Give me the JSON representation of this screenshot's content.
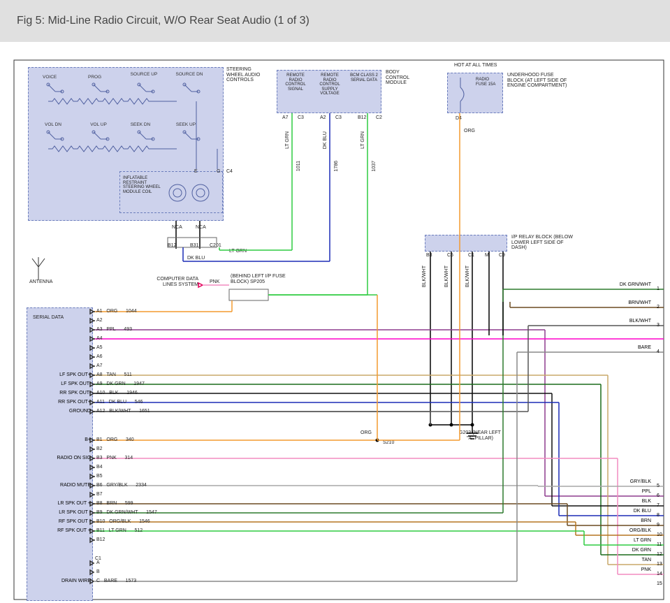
{
  "header": {
    "title": "Fig 5: Mid-Line Radio Circuit, W/O Rear Seat Audio (1 of 3)"
  },
  "modules": {
    "steering": {
      "title": "STEERING WHEEL AUDIO CONTROLS",
      "buttons": [
        "VOICE",
        "PROG",
        "SOURCE UP",
        "SOURCE DN",
        "VOL DN",
        "VOL UP",
        "SEEK DN",
        "SEEK UP"
      ],
      "coil": "INFLATABLE RESTRAINT STEERING WHEEL MODULE COIL"
    },
    "bcm": {
      "title": "BODY CONTROL MODULE",
      "col1": "REMOTE RADIO CONTROL SIGNAL",
      "col2": "REMOTE RADIO CONTROL SUPPLY VOLTAGE",
      "col3": "BCM CLASS 2 SERIAL DATA"
    },
    "bcm_pins": {
      "p1": "A7",
      "c1": "C3",
      "p2": "A2",
      "c2": "C3",
      "p3": "B12",
      "c3": "C2"
    },
    "bcm_wires": {
      "w1": "LT GRN",
      "n1": "1011",
      "w2": "DK BLU",
      "n2": "1786",
      "w3": "LT GRN",
      "n3": "1037"
    },
    "fuseblock": {
      "title": "UNDERHOOD FUSE BLOCK (AT LEFT SIDE OF ENGINE COMPARTMENT)",
      "hot": "HOT AT ALL TIMES",
      "fuse": "RADIO FUSE 15A",
      "pin": "D4",
      "wire": "ORG"
    },
    "iprelay": {
      "title": "I/P RELAY BLOCK (BELOW LOWER LEFT SIDE OF DASH)",
      "pins": [
        "B3",
        "C5",
        "C1",
        "M",
        "C9"
      ]
    },
    "sp205": {
      "text": "(BEHIND LEFT I/P FUSE BLOCK) SP205"
    },
    "datasys": {
      "text": "COMPUTER DATA LINES SYSTEM",
      "wire": "PNK"
    },
    "g203": {
      "text": "G203 (NEAR LEFT \"A\" PILLAR)"
    },
    "s210": "S210",
    "antenna": "ANTENNA",
    "blkwht": "BLK/WHT"
  },
  "coil_pins": {
    "e": "E",
    "g": "G",
    "c4": "C4",
    "nca": "NCA",
    "b12": "B12",
    "b31": "B31",
    "c201": "C201",
    "dkblu": "DK BLU",
    "ltgrn": "LT GRN"
  },
  "radio": {
    "serial": "SERIAL DATA",
    "rows_a": [
      {
        "pin": "A1",
        "c": "ORG",
        "n": "1044",
        "left": ""
      },
      {
        "pin": "A2",
        "c": "",
        "n": "",
        "left": ""
      },
      {
        "pin": "A3",
        "c": "PPL",
        "n": "493",
        "left": ""
      },
      {
        "pin": "A4",
        "c": "",
        "n": "",
        "left": ""
      },
      {
        "pin": "A5",
        "c": "",
        "n": "",
        "left": ""
      },
      {
        "pin": "A6",
        "c": "",
        "n": "",
        "left": ""
      },
      {
        "pin": "A7",
        "c": "",
        "n": "",
        "left": ""
      },
      {
        "pin": "A8",
        "c": "TAN",
        "n": "511",
        "left": "LF SPK OUT+"
      },
      {
        "pin": "A9",
        "c": "DK GRN",
        "n": "1947",
        "left": "LF SPK OUT-"
      },
      {
        "pin": "A10",
        "c": "BLK",
        "n": "1946",
        "left": "RR SPK OUT-"
      },
      {
        "pin": "A11",
        "c": "DK BLU",
        "n": "546",
        "left": "RR SPK OUT+"
      },
      {
        "pin": "A12",
        "c": "BLK/WHT",
        "n": "1651",
        "left": "GROUND"
      }
    ],
    "rows_b": [
      {
        "pin": "B1",
        "c": "ORG",
        "n": "340",
        "left": "B+"
      },
      {
        "pin": "B2",
        "c": "",
        "n": "",
        "left": ""
      },
      {
        "pin": "B3",
        "c": "PNK",
        "n": "314",
        "left": "RADIO ON SIG"
      },
      {
        "pin": "B4",
        "c": "",
        "n": "",
        "left": ""
      },
      {
        "pin": "B5",
        "c": "",
        "n": "",
        "left": ""
      },
      {
        "pin": "B6",
        "c": "GRY/BLK",
        "n": "2334",
        "left": "RADIO MUTE"
      },
      {
        "pin": "B7",
        "c": "",
        "n": "",
        "left": ""
      },
      {
        "pin": "B8",
        "c": "BRN",
        "n": "599",
        "left": "LR SPK OUT +"
      },
      {
        "pin": "B9",
        "c": "DK GRN/WHT",
        "n": "1547",
        "left": "LR SPK OUT -"
      },
      {
        "pin": "B10",
        "c": "ORG/BLK",
        "n": "1546",
        "left": "RF SPK OUT -"
      },
      {
        "pin": "B11",
        "c": "LT GRN",
        "n": "512",
        "left": "RF SPK OUT +"
      },
      {
        "pin": "B12",
        "c": "",
        "n": "",
        "left": ""
      }
    ],
    "c1": "C1",
    "rows_c": [
      {
        "pin": "A",
        "c": "",
        "n": "",
        "left": ""
      },
      {
        "pin": "B",
        "c": "",
        "n": "",
        "left": ""
      },
      {
        "pin": "C",
        "c": "BARE",
        "n": "1573",
        "left": "DRAIN WIRE"
      }
    ]
  },
  "right_out": [
    {
      "c": "DK GRN/WHT",
      "n": "1"
    },
    {
      "c": "BRN/WHT",
      "n": "2"
    },
    {
      "c": "BLK/WHT",
      "n": "3"
    },
    {
      "c": "BARE",
      "n": "4"
    },
    {
      "c": "GRY/BLK",
      "n": "5"
    },
    {
      "c": "PPL",
      "n": "6"
    },
    {
      "c": "BLK",
      "n": "7"
    },
    {
      "c": "DK BLU",
      "n": "8"
    },
    {
      "c": "BRN",
      "n": "9"
    },
    {
      "c": "ORG/BLK",
      "n": "10"
    },
    {
      "c": "LT GRN",
      "n": "11"
    },
    {
      "c": "DK GRN",
      "n": "12"
    },
    {
      "c": "TAN",
      "n": "13"
    },
    {
      "c": "PNK",
      "n": "14"
    },
    {
      "c": "",
      "n": "15"
    }
  ],
  "wire_colors": {
    "ORG": "#f39a2f",
    "PPL": "#8e3b8e",
    "TAN": "#c9a86a",
    "DK GRN": "#1a6b1a",
    "BLK": "#111",
    "DK BLU": "#1b2cb5",
    "BLK/WHT": "#555",
    "PNK": "#f28bc0",
    "GRY/BLK": "#a7a7a7",
    "BRN": "#6b4a20",
    "DK GRN/WHT": "#2d7a2d",
    "ORG/BLK": "#b57520",
    "LT GRN": "#2ecc40",
    "BARE": "#888",
    "MAGENTA": "#ff00cc"
  }
}
